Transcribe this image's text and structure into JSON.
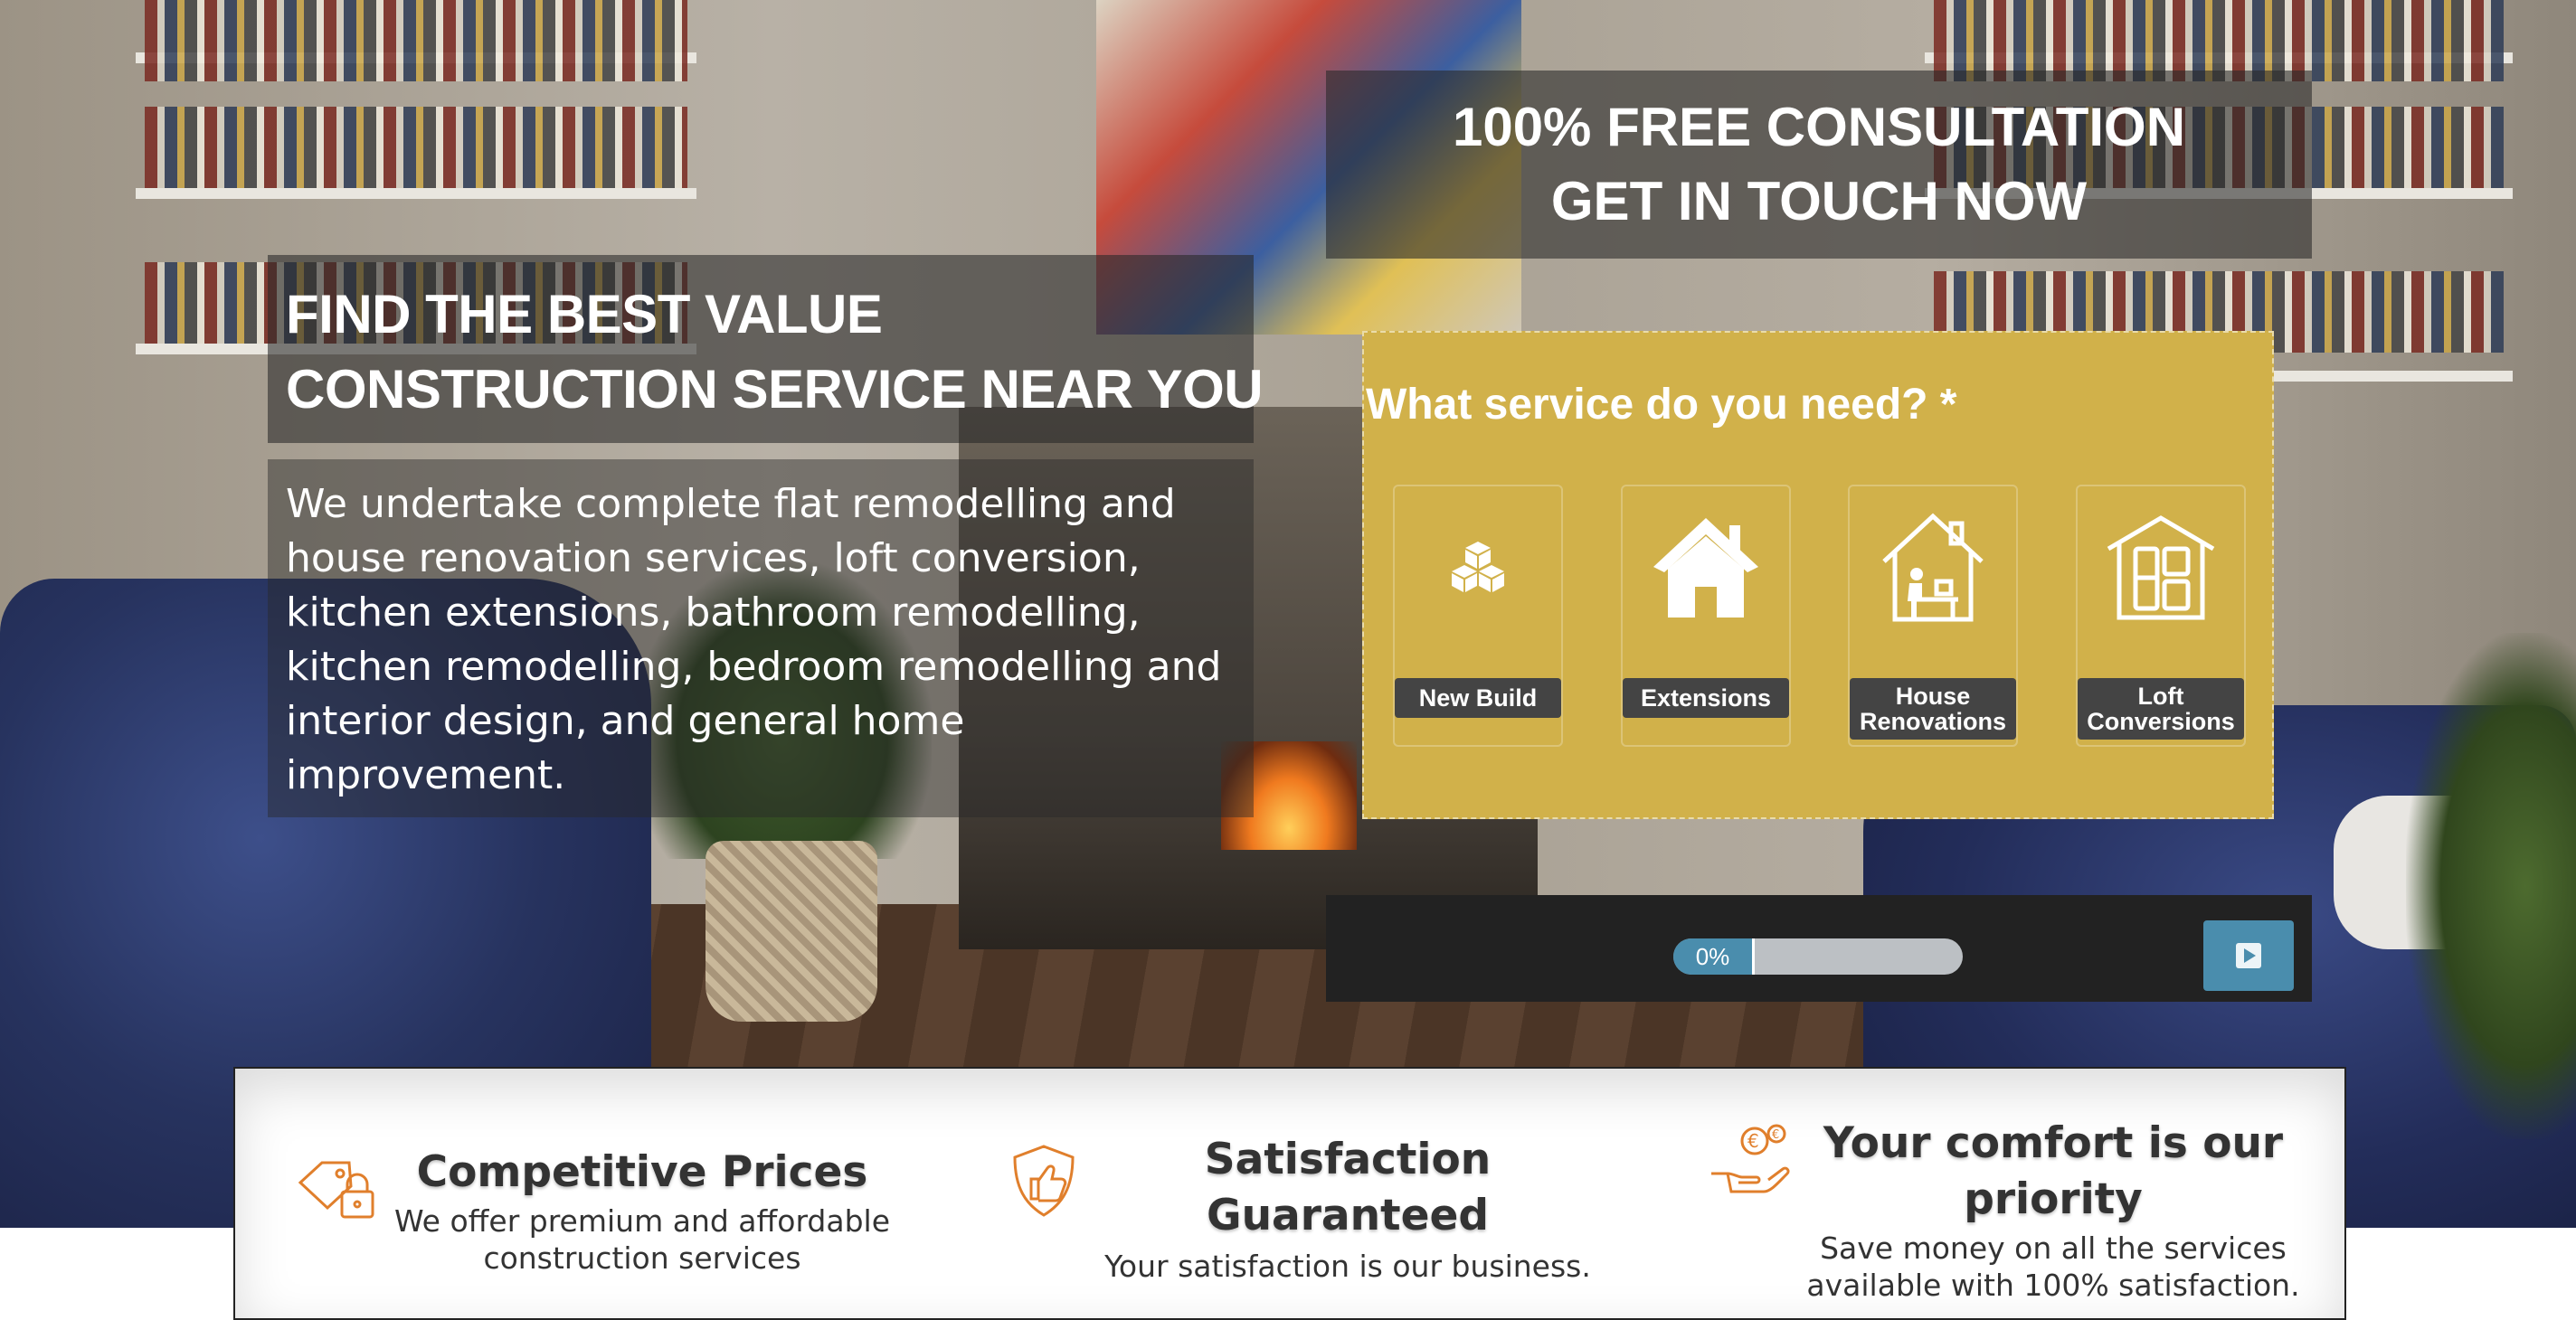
{
  "hero": {
    "headline": [
      "FIND THE BEST VALUE",
      "CONSTRUCTION SERVICE NEAR YOU"
    ],
    "description": "We undertake complete flat remodelling and house renovation services, loft conversion, kitchen extensions, bathroom remodelling, kitchen remodelling, bedroom remodelling and interior design, and general home improvement."
  },
  "consultation": {
    "lines": [
      "100% FREE CONSULTATION",
      "GET IN TOUCH NOW"
    ]
  },
  "form": {
    "question": "What service do you need? *",
    "panel_color": "#d1b14a",
    "services": [
      {
        "label": "New Build",
        "icon": "blocks-icon"
      },
      {
        "label": "Extensions",
        "icon": "house-icon"
      },
      {
        "label": "House Renovations",
        "icon": "house-desk-icon"
      },
      {
        "label": "Loft Conversions",
        "icon": "window-house-icon"
      }
    ]
  },
  "progress": {
    "value_percent": 0,
    "label": "0%",
    "accent": "#4a8dad",
    "next_icon": "play-icon"
  },
  "features": [
    {
      "title": "Competitive Prices",
      "text": "We offer premium and affordable construction services",
      "icon": "price-tag-lock-icon"
    },
    {
      "title": "Satisfaction Guaranteed",
      "text": "Your satisfaction is our business.",
      "icon": "shield-thumbs-up-icon"
    },
    {
      "title": "Your comfort is our priority",
      "text": "Save money on all the services available with 100% satisfaction.",
      "icon": "hand-coins-icon"
    }
  ],
  "colors": {
    "icon_orange": "#e07f2c",
    "label_dark": "#444444"
  }
}
